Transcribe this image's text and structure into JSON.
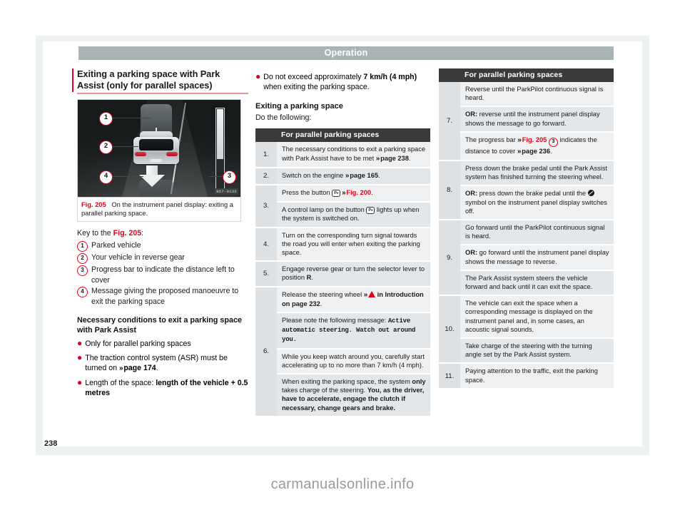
{
  "header": {
    "chapter": "Operation"
  },
  "folio": {
    "page_number": "238"
  },
  "watermark": {
    "text": "carmanualsonline.info"
  },
  "left_column": {
    "section_title": "Exiting a parking space with Park Assist (only for parallel spaces)",
    "figure": {
      "image_code": "B57-0136",
      "caption_label": "Fig. 205",
      "caption_text": "On the instrument panel display: exiting a parallel parking space.",
      "callouts": [
        "1",
        "2",
        "4",
        "3"
      ]
    },
    "key_intro_prefix": "Key to the ",
    "key_intro_ref": "Fig. 205",
    "key_intro_suffix": ":",
    "key_items": [
      {
        "num": "1",
        "text": "Parked vehicle"
      },
      {
        "num": "2",
        "text": "Your vehicle in reverse gear"
      },
      {
        "num": "3",
        "text": "Progress bar to indicate the distance left to cover"
      },
      {
        "num": "4",
        "text": "Message giving the proposed manoeuvre to exit the parking space"
      }
    ],
    "conditions_heading": "Necessary conditions to exit a parking space with Park Assist",
    "conditions": [
      {
        "text": "Only for parallel parking spaces"
      },
      {
        "text_before": "The traction control system (ASR) must be turned on ",
        "ref": "page 174",
        "text_after": "."
      },
      {
        "text_before": "Length of the space: ",
        "bold": "length of the vehicle + 0.5 metres",
        "text_after": ""
      }
    ]
  },
  "mid_column": {
    "top_bullet_before": "Do not exceed approximately ",
    "top_bullet_bold1": "7 km/h (4 mph)",
    "top_bullet_after": " when exiting the parking space.",
    "heading": "Exiting a parking space",
    "intro": "Do the following:",
    "table": {
      "header_num": "",
      "header_text": "For parallel parking spaces",
      "rows": [
        {
          "num": "1.",
          "cells": [
            {
              "before": "The necessary conditions to exit a parking space with Park Assist have to be met ",
              "ref": "page 238",
              "after": "."
            }
          ]
        },
        {
          "num": "2.",
          "cells": [
            {
              "before": "Switch on the engine ",
              "ref": "page 165",
              "after": "."
            }
          ]
        },
        {
          "num": "3.",
          "cells": [
            {
              "before": "Press the button ",
              "icon": "park-assist-button-icon",
              "ref_red": "Fig. 200",
              "after": "."
            },
            {
              "before": "A control lamp on the button ",
              "icon": "park-assist-button-icon",
              "after2": " lights up when the system is switched on."
            }
          ]
        },
        {
          "num": "4.",
          "cells": [
            {
              "before": "Turn on the corresponding turn signal towards the road you will enter when exiting the parking space."
            }
          ]
        },
        {
          "num": "5.",
          "cells": [
            {
              "before": "Engage reverse gear or turn the selector lever to position ",
              "bold": "R",
              "after": "."
            }
          ]
        },
        {
          "num": "6.",
          "cells": [
            {
              "before": "Release the steering wheel ",
              "icon": "warning-triangle-icon",
              "bold_after": " in Introduction on page 232",
              "after": "."
            },
            {
              "before": "Please note the following message: ",
              "mono": "Active automatic steering. Watch out around you."
            },
            {
              "before": "While you keep watch around you, carefully start accelerating up to no more than 7 km/h (4 mph)."
            },
            {
              "before": "When exiting the parking space, the system ",
              "bold": "only",
              "mid": " takes charge of the steering. ",
              "bold2": "You, as the driver, have to accelerate, engage the clutch if necessary, change gears and brake."
            }
          ]
        }
      ]
    }
  },
  "right_column": {
    "table": {
      "header_num": "",
      "header_text": "For parallel parking spaces",
      "rows": [
        {
          "num": "7.",
          "cells": [
            {
              "before": "Reverse until the ParkPilot continuous signal is heard."
            },
            {
              "bold": "OR:",
              "after": " reverse until the instrument panel display shows the message to go forward."
            },
            {
              "before": "The progress bar ",
              "ref_red": "Fig. 205",
              "circ": "3",
              "mid": " indicates the distance to cover ",
              "ref": "page 236",
              "after": "."
            }
          ]
        },
        {
          "num": "8.",
          "cells": [
            {
              "before": "Press down the brake pedal until the Park Assist system has finished turning the steering wheel."
            },
            {
              "bold": "OR:",
              "mid": " press down the brake pedal until the ",
              "icon": "no-steering-symbol-icon",
              "after": " symbol on the instrument panel display switches off."
            }
          ]
        },
        {
          "num": "9.",
          "cells": [
            {
              "before": "Go forward until the ParkPilot continuous signal is heard."
            },
            {
              "bold": "OR:",
              "after": " go forward until the instrument panel display shows the message to reverse."
            },
            {
              "before": "The Park Assist system steers the vehicle forward and back until it can exit the space."
            }
          ]
        },
        {
          "num": "10.",
          "cells": [
            {
              "before": "The vehicle can exit the space when a corresponding message is displayed on the instrument panel and, in some cases, an acoustic signal sounds."
            },
            {
              "before": "Take charge of the steering with the turning angle set by the Park Assist system."
            }
          ]
        },
        {
          "num": "11.",
          "cells": [
            {
              "before": "Paying attention to the traffic, exit the parking space."
            }
          ]
        }
      ]
    }
  },
  "colors": {
    "accent_red": "#e2001a",
    "header_bar": "#a9b5b4",
    "table_header": "#3a3a3a",
    "row_shade_a": "#eef0f2",
    "row_shade_b": "#e4e7ea",
    "num_cell": "#dde1e4"
  }
}
